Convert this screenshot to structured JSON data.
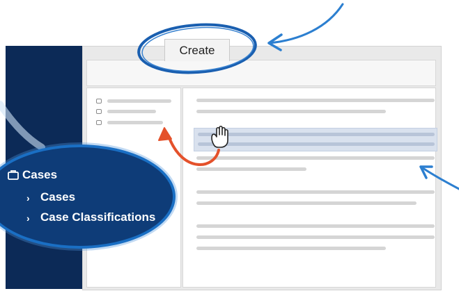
{
  "toolbar": {
    "create_label": "Create"
  },
  "menu": {
    "title": "Cases",
    "items": [
      {
        "label": "Cases"
      },
      {
        "label": "Case Classifications"
      }
    ]
  },
  "icons": {
    "cases": "briefcase-icon",
    "chevron": "chevron-right-icon",
    "cursor": "hand-cursor-icon"
  },
  "colors": {
    "navy": "#0c2a57",
    "menu_blue": "#0e3c78",
    "accent_blue": "#1a6fc4",
    "arrow_orange": "#e4512b",
    "highlight": "#d9e1ee"
  }
}
